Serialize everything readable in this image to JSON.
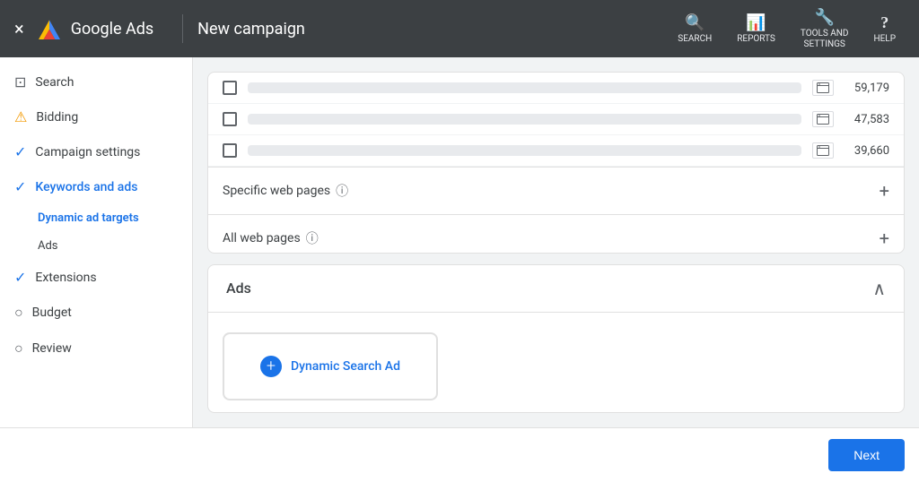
{
  "header": {
    "title": "New campaign",
    "logo_text": "Google Ads",
    "close_label": "×",
    "actions": [
      {
        "id": "search",
        "icon": "🔍",
        "label": "SEARCH"
      },
      {
        "id": "reports",
        "icon": "📊",
        "label": "REPORTS"
      },
      {
        "id": "tools",
        "icon": "🔧",
        "label": "TOOLS AND\nSETTINGS"
      },
      {
        "id": "help",
        "icon": "?",
        "label": "HELP"
      }
    ]
  },
  "sidebar": {
    "items": [
      {
        "id": "search",
        "icon": "search",
        "label": "Search",
        "type": "icon"
      },
      {
        "id": "bidding",
        "icon": "warning",
        "label": "Bidding",
        "type": "warning"
      },
      {
        "id": "campaign-settings",
        "icon": "check",
        "label": "Campaign settings",
        "type": "check"
      },
      {
        "id": "keywords-and-ads",
        "icon": "check",
        "label": "Keywords and ads",
        "type": "check",
        "active": true
      }
    ],
    "sub_items": [
      {
        "id": "dynamic-ad-targets",
        "label": "Dynamic ad targets",
        "active": true
      },
      {
        "id": "ads",
        "label": "Ads",
        "active": false
      }
    ],
    "bottom_items": [
      {
        "id": "extensions",
        "icon": "check",
        "label": "Extensions",
        "type": "check"
      },
      {
        "id": "budget",
        "icon": "circle",
        "label": "Budget",
        "type": "circle"
      },
      {
        "id": "review",
        "icon": "circle",
        "label": "Review",
        "type": "circle"
      }
    ]
  },
  "table_rows": [
    {
      "value": "59,179"
    },
    {
      "value": "47,583"
    },
    {
      "value": "39,660"
    }
  ],
  "section_rows": [
    {
      "id": "specific-web-pages",
      "label": "Specific web pages",
      "has_help": true
    },
    {
      "id": "all-web-pages",
      "label": "All web pages",
      "has_help": true
    }
  ],
  "ads_section": {
    "title": "Ads",
    "dynamic_search_ad_label": "Dynamic Search Ad"
  },
  "footer": {
    "next_label": "Next"
  }
}
